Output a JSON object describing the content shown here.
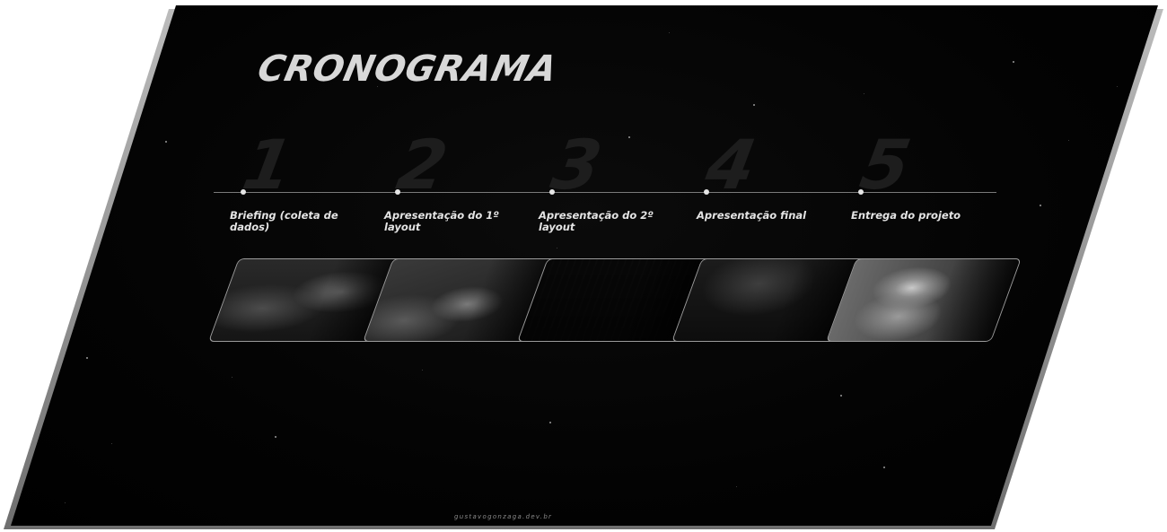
{
  "title": "CRONOGRAMA",
  "steps": [
    {
      "number": "1",
      "label": " Briefing (coleta de\ndados)",
      "image": "person-working-at-desk-photo"
    },
    {
      "number": "2",
      "label": " Apresentação do 1º\nlayout",
      "image": "hand-sketching-on-paper-photo"
    },
    {
      "number": "3",
      "label": " Apresentação do 2º\nlayout",
      "image": "monitors-with-code-photo"
    },
    {
      "number": "4",
      "label": "Apresentação final",
      "image": "dark-desk-with-screen-photo"
    },
    {
      "number": "5",
      "label": "Entrega do projeto",
      "image": "happy-woman-at-computer-photo"
    }
  ],
  "footer": "gustavogonzaga.dev.br",
  "colors": {
    "background": "#000000",
    "title": "#d8d8d8",
    "number": "#1d1d1d",
    "accent": "#e6e6e6"
  }
}
